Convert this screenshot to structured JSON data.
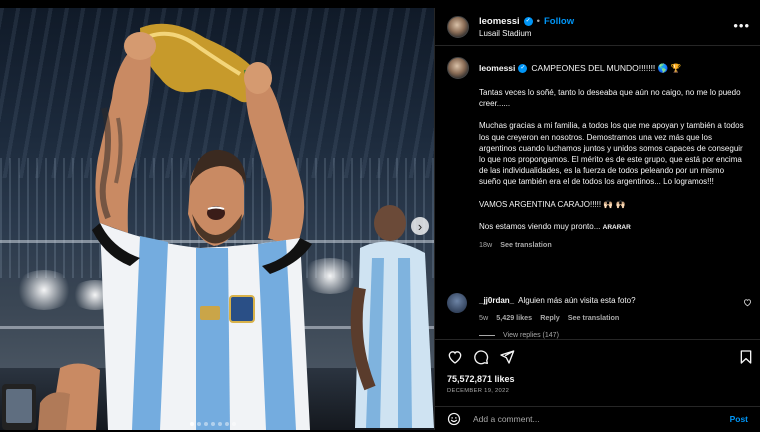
{
  "post": {
    "username": "leomessi",
    "follow_label": "Follow",
    "separator": "•",
    "location": "Lusail Stadium",
    "more_label": "•••",
    "carousel_next": "›"
  },
  "caption": {
    "username": "leomessi",
    "title": "CAMPEONES DEL MUNDO!!!!!!! 🌎 🏆",
    "paragraphs": [
      "Tantas veces lo soñé, tanto lo deseaba que aún no caigo, no me lo puedo creer......",
      "Muchas gracias a mi familia, a todos los que me apoyan y también a todos los que creyeron en nosotros. Demostramos una vez más que los argentinos cuando luchamos juntos y unidos somos capaces de conseguir lo que nos propongamos. El mérito es de este grupo, que está por encima de las individualidades, es la fuerza de todos peleando por un mismo sueño que también era el de todos los argentinos... Lo logramos!!!",
      "VAMOS ARGENTINA CARAJO!!!!! 🙌🏻 🙌🏻"
    ],
    "last_line": "Nos estamos viendo muy pronto...",
    "last_line_small": "ARARAR",
    "age": "18w",
    "see_translation": "See translation"
  },
  "comment": {
    "username": "_jj0rdan_",
    "text": "Alguien más aún visita esta foto?",
    "age": "5w",
    "likes": "5,429 likes",
    "reply": "Reply",
    "see_translation": "See translation",
    "view_replies": "View replies (147)"
  },
  "stats": {
    "likes": "75,572,871 likes",
    "date": "DECEMBER 19, 2022"
  },
  "add_comment": {
    "placeholder": "Add a comment...",
    "post_label": "Post"
  },
  "colors": {
    "accent": "#0095f6",
    "background": "#000000",
    "text": "#f5f5f5",
    "secondary_text": "#a8a8a8"
  },
  "icons": [
    "verified-badge-icon",
    "more-icon",
    "heart-icon",
    "comment-icon",
    "share-icon",
    "bookmark-icon",
    "emoji-icon",
    "chevron-right-icon"
  ]
}
